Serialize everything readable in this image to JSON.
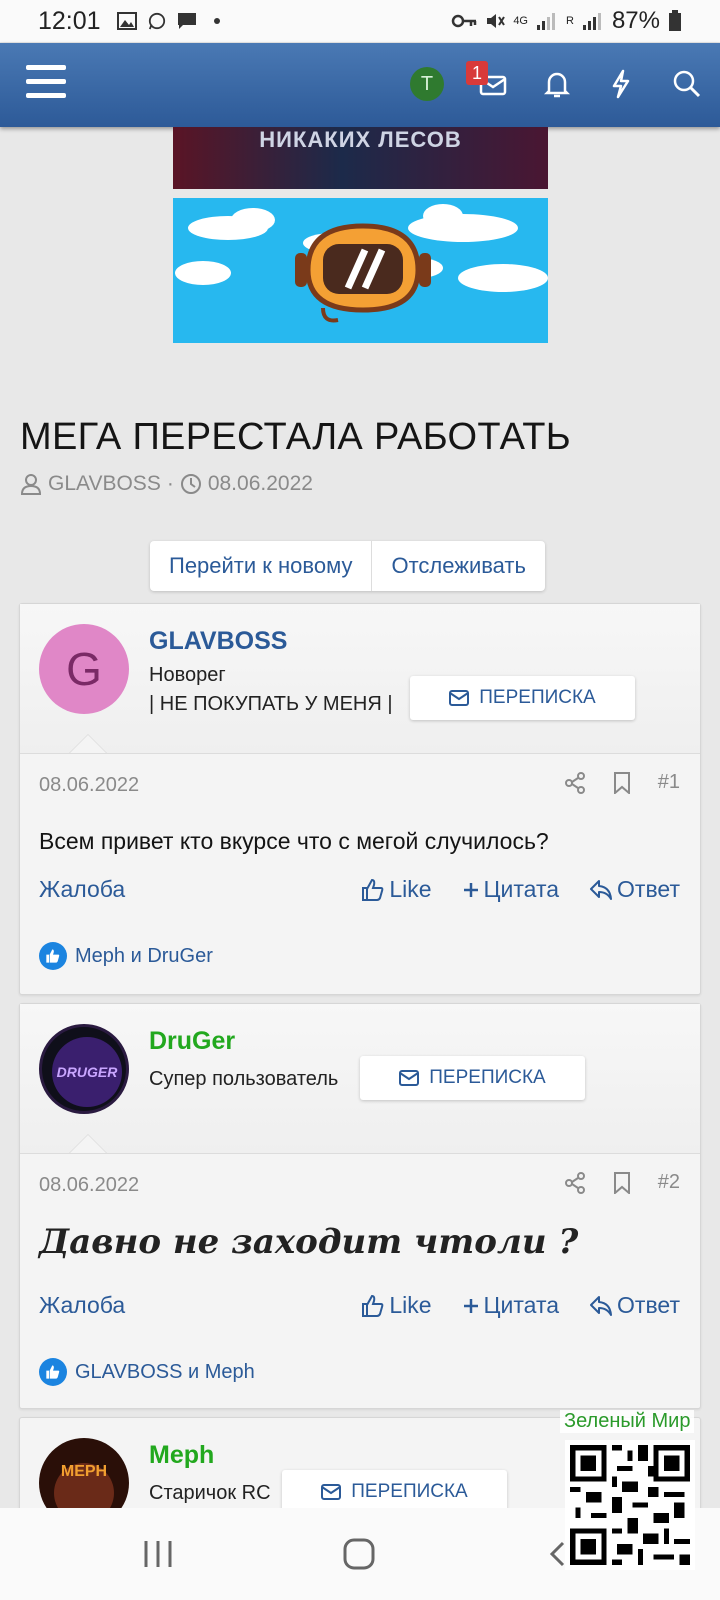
{
  "status": {
    "time": "12:01",
    "battery": "87%",
    "network": "4G",
    "roaming": "R"
  },
  "header": {
    "avatar_letter": "T",
    "badge_count": "1"
  },
  "banner": {
    "text": "НИКАКИХ ЛЕСОВ"
  },
  "thread": {
    "title": "МЕГА ПЕРЕСТАЛА РАБОТАТЬ",
    "author": "GLAVBOSS",
    "separator": "·",
    "date": "08.06.2022"
  },
  "buttons": {
    "new": "Перейти к новому",
    "watch": "Отслеживать"
  },
  "pm_label": "ПЕРЕПИСКА",
  "labels": {
    "report": "Жалоба",
    "like": "Like",
    "quote": "Цитата",
    "reply": "Ответ"
  },
  "posts": [
    {
      "author": "GLAVBOSS",
      "author_color": "#2b5a98",
      "avatar_letter": "G",
      "avatar_color": "#e087c7",
      "role": "Новорег",
      "tagline": "| НЕ ПОКУПАТЬ У МЕНЯ |",
      "date": "08.06.2022",
      "number": "#1",
      "body": "Всем привет кто вкурсе что с мегой случилось?",
      "likes": "Meph и DruGer"
    },
    {
      "author": "DruGer",
      "author_color": "#22a81e",
      "avatar_text": "DRUGER",
      "role": "Супер пользователь",
      "date": "08.06.2022",
      "number": "#2",
      "body": "Давно не заходит чтоли ?",
      "likes": "GLAVBOSS и Meph"
    },
    {
      "author": "Meph",
      "author_color": "#22a81e",
      "avatar_text": "MEPH",
      "role": "Старичок RC"
    }
  ],
  "watermark": {
    "label": "Зеленый Мир"
  },
  "colors": {
    "accent": "#2b5a98",
    "header": "#3b6aa8",
    "green": "#22a81e"
  }
}
